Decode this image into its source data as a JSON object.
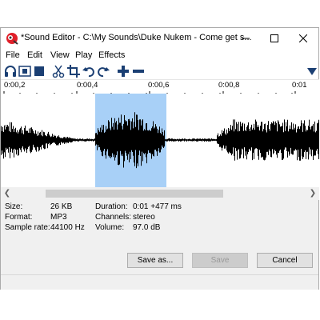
{
  "window": {
    "title": "*Sound Editor - C:\\My Sounds\\Duke Nukem - Come get s...",
    "minimize_glyph": "—",
    "maximize_glyph": "☐",
    "close_glyph": "✕"
  },
  "menu": [
    "File",
    "Edit",
    "View",
    "Play",
    "Effects"
  ],
  "toolbar": {
    "icons": [
      "headphones-icon",
      "play-selection-icon",
      "stop-icon",
      "cut-icon",
      "crop-icon",
      "undo-icon",
      "redo-icon",
      "plus-icon",
      "minus-icon",
      "dropdown-arrow-icon"
    ]
  },
  "ruler": {
    "labels": [
      "0:00,2",
      "0:00,4",
      "0:00,6",
      "0:00,8",
      "0:01"
    ]
  },
  "waveform": {
    "color": "#000000",
    "selection_color": "#a8d0f7"
  },
  "info": {
    "size_label": "Size:",
    "size_value": "26 KB",
    "format_label": "Format:",
    "format_value": "MP3",
    "rate_label": "Sample rate:",
    "rate_value": "44100 Hz",
    "duration_label": "Duration:",
    "duration_value": "0:01 +477 ms",
    "channels_label": "Channels:",
    "channels_value": "stereo",
    "volume_label": "Volume:",
    "volume_value": "97.0 dB"
  },
  "buttons": {
    "save_as": "Save as...",
    "save": "Save",
    "cancel": "Cancel"
  }
}
